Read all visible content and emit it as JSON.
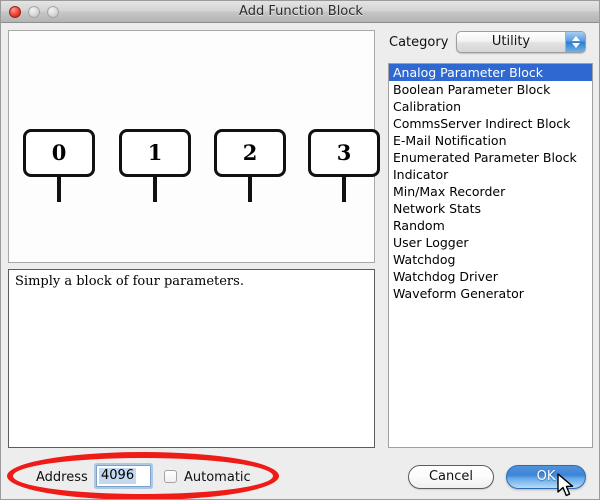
{
  "window": {
    "title": "Add Function Block",
    "traffic_lights": [
      "close",
      "minimize",
      "zoom"
    ]
  },
  "preview": {
    "blocks": [
      {
        "label": "0"
      },
      {
        "label": "1"
      },
      {
        "label": "2"
      },
      {
        "label": "3"
      }
    ]
  },
  "description": {
    "text": "Simply a block of four parameters."
  },
  "category": {
    "label": "Category",
    "selected": "Utility",
    "options": [
      "Utility"
    ],
    "items": [
      {
        "label": "Analog Parameter Block",
        "selected": true
      },
      {
        "label": "Boolean Parameter Block",
        "selected": false
      },
      {
        "label": "Calibration",
        "selected": false
      },
      {
        "label": "CommsServer Indirect Block",
        "selected": false
      },
      {
        "label": "E-Mail Notification",
        "selected": false
      },
      {
        "label": "Enumerated Parameter Block",
        "selected": false
      },
      {
        "label": "Indicator",
        "selected": false
      },
      {
        "label": "Min/Max Recorder",
        "selected": false
      },
      {
        "label": "Network Stats",
        "selected": false
      },
      {
        "label": "Random",
        "selected": false
      },
      {
        "label": "User Logger",
        "selected": false
      },
      {
        "label": "Watchdog",
        "selected": false
      },
      {
        "label": "Watchdog Driver",
        "selected": false
      },
      {
        "label": "Waveform Generator",
        "selected": false
      }
    ]
  },
  "footer": {
    "address_label": "Address",
    "address_value": "4096",
    "address_placeholder": "4096",
    "automatic_label": "Automatic",
    "automatic_checked": false,
    "cancel_label": "Cancel",
    "ok_label": "OK"
  },
  "colors": {
    "selection_blue": "#2f68d0",
    "default_button_blue": "#3f84d6",
    "annotation_red": "#ee1b17",
    "field_selection": "#c3d9f0"
  }
}
